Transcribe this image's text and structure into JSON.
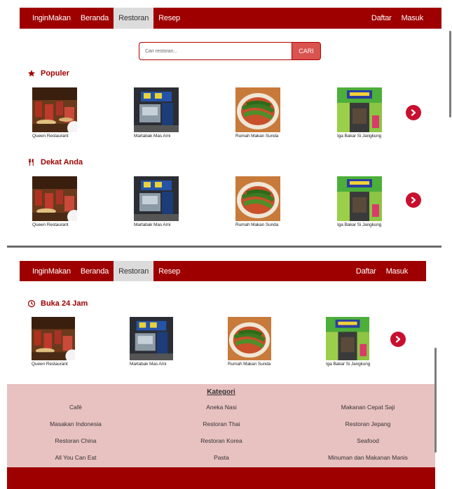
{
  "navbar": {
    "brand": "InginMakan",
    "items": [
      {
        "label": "Beranda"
      },
      {
        "label": "Restoran"
      },
      {
        "label": "Resep"
      }
    ],
    "right": [
      {
        "label": "Daftar"
      },
      {
        "label": "Masuk"
      }
    ]
  },
  "search": {
    "placeholder": "Cari restoran...",
    "button_label": "CARI"
  },
  "sections": [
    {
      "title": "Populer",
      "icon": "star-icon"
    },
    {
      "title": "Dekat Anda",
      "icon": "cutlery-icon"
    },
    {
      "title": "Buka 24 Jam",
      "icon": "clock-icon"
    }
  ],
  "restaurants": [
    {
      "name": "Queen Restaurant"
    },
    {
      "name": "Martabak Mas Ami"
    },
    {
      "name": "Rumah Makan Sunda"
    },
    {
      "name": "Iga Bakar Si Jangkung"
    }
  ],
  "kategori": {
    "title": "Kategori",
    "items": [
      "Cafè",
      "Aneka Nasi",
      "Makanan Cepat Saji",
      "Masakan Indonesia",
      "Restoran Thai",
      "Restoran Jepang",
      "Restoran China",
      "Restoran Korea",
      "Seafood",
      "All You Can Eat",
      "Pasta",
      "Minuman dan Makanan Manis"
    ]
  },
  "colors": {
    "brand_red": "#9e0000",
    "arrow_red": "#c8102e",
    "footer_pink": "#e8c1c1"
  }
}
